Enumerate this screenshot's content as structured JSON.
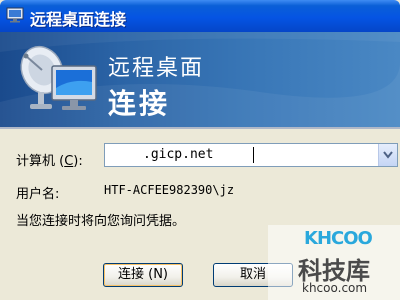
{
  "window": {
    "title": "远程桌面连接",
    "icon": "remote-desktop-icon"
  },
  "banner": {
    "line1": "远程桌面",
    "line2": "连接",
    "logo": "monitor-with-dish-icon"
  },
  "form": {
    "computer_label_prefix": "计算机 (",
    "computer_label_key": "C",
    "computer_label_suffix": "):",
    "computer_value": ".gicp.net",
    "username_label": "用户名:",
    "username_value": "HTF-ACFEE982390\\jz",
    "prompt_text": "当您连接时将向您询问凭据。"
  },
  "buttons": {
    "connect": "连接 (N)",
    "cancel": "取消"
  },
  "watermark": {
    "logo": "KHCOO",
    "text": "科技库",
    "url": "khcoo.com"
  },
  "colors": {
    "titlebar": "#0554e3",
    "banner": "#2b64a6",
    "dialog_bg": "#ece9d8",
    "watermark_blue": "#2aa8dc"
  }
}
